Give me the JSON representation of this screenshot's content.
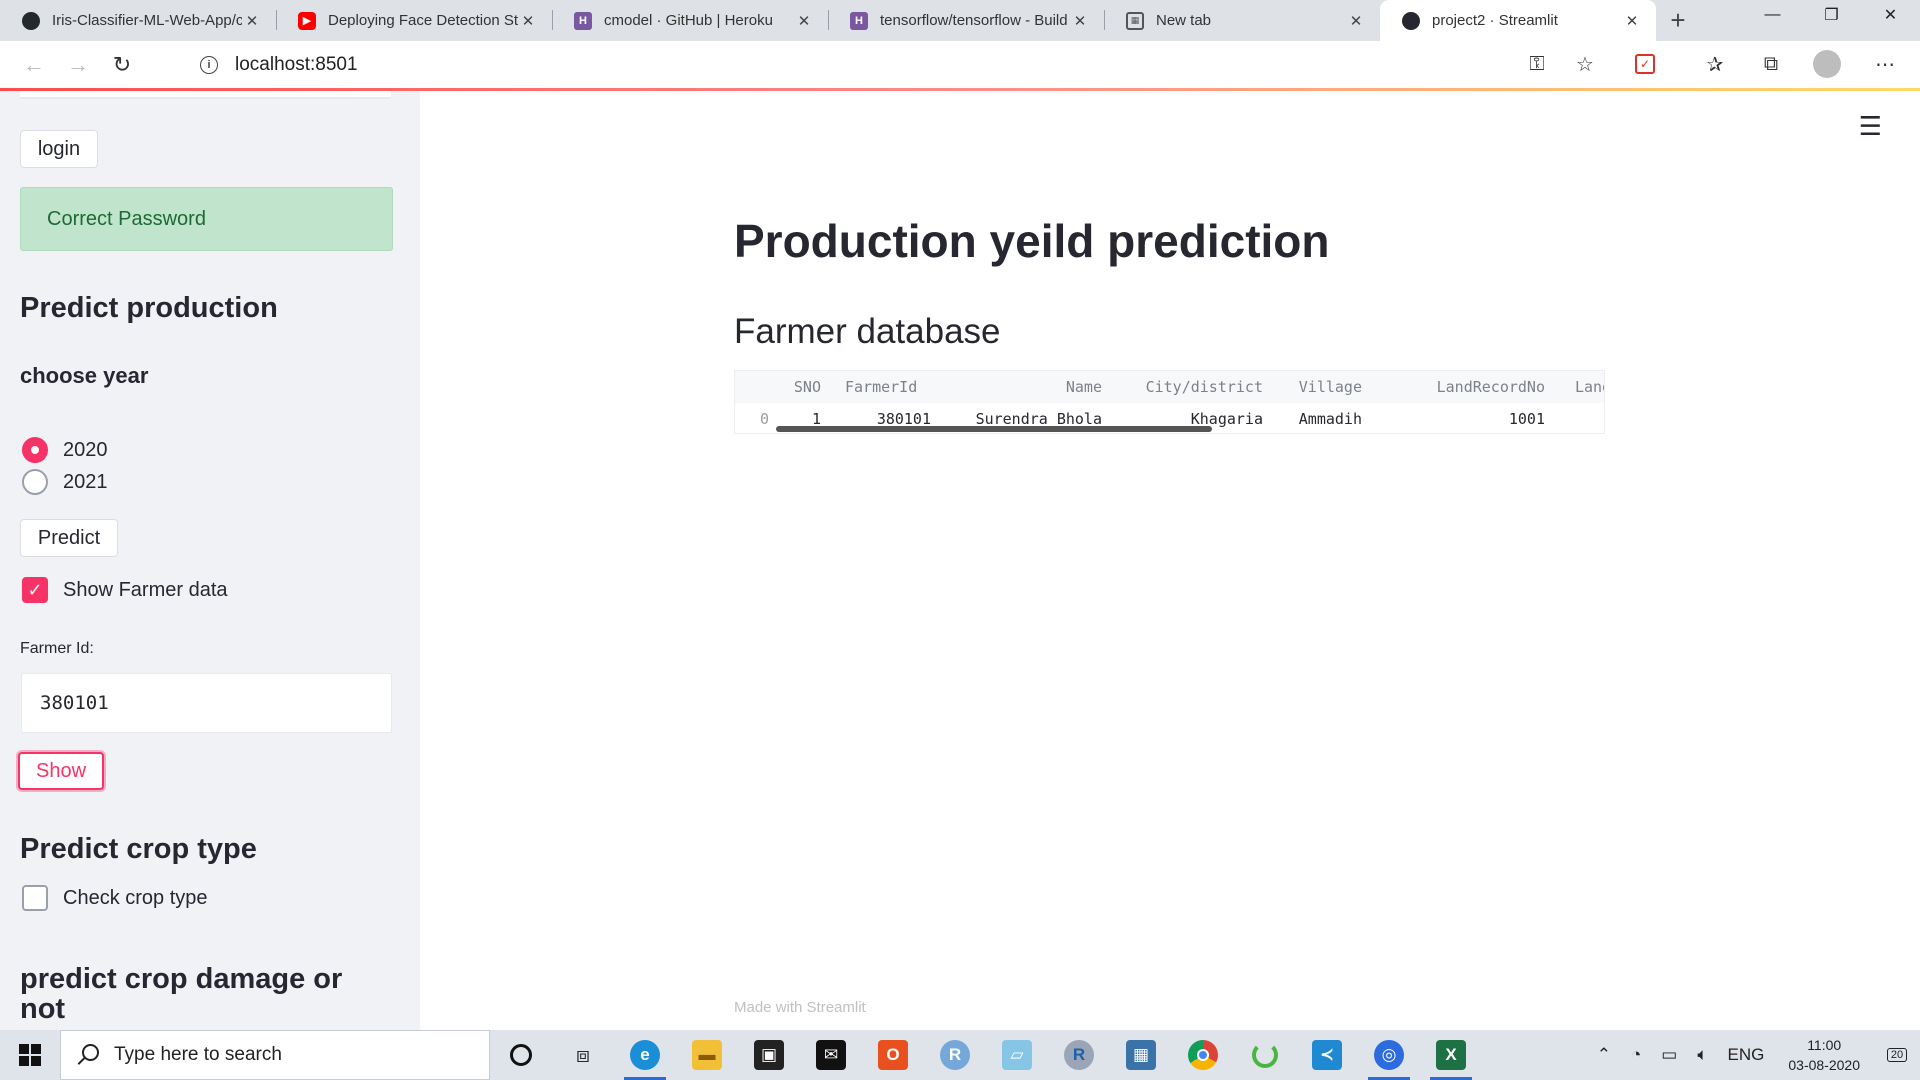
{
  "browser": {
    "tabs": [
      {
        "title": "Iris-Classifier-ML-Web-App/c",
        "favicon": "github-icon",
        "active": false
      },
      {
        "title": "Deploying Face Detection St",
        "favicon": "youtube-icon",
        "active": false
      },
      {
        "title": "cmodel · GitHub | Heroku",
        "favicon": "heroku-icon",
        "active": false
      },
      {
        "title": "tensorflow/tensorflow - Build",
        "favicon": "heroku-icon",
        "active": false
      },
      {
        "title": "New tab",
        "favicon": "newtab-icon",
        "active": false
      },
      {
        "title": "project2 · Streamlit",
        "favicon": "streamlit-icon",
        "active": true
      }
    ],
    "url": "localhost:8501"
  },
  "sidebar": {
    "login_button": "login",
    "success_message": "Correct Password",
    "predict_production_heading": "Predict production",
    "choose_year_label": "choose year",
    "year_options": [
      {
        "label": "2020",
        "selected": true
      },
      {
        "label": "2021",
        "selected": false
      }
    ],
    "predict_button": "Predict",
    "show_farmer_checkbox": {
      "label": "Show Farmer data",
      "checked": true
    },
    "farmer_id_label": "Farmer Id:",
    "farmer_id_value": "380101",
    "show_button": "Show",
    "predict_crop_type_heading": "Predict crop type",
    "check_crop_type_checkbox": {
      "label": "Check crop type",
      "checked": false
    },
    "predict_damage_heading": "predict crop damage or not"
  },
  "main": {
    "title": "Production yeild prediction",
    "section_title": "Farmer database",
    "table": {
      "columns": [
        "",
        "SNO",
        "FarmerId",
        "Name",
        "City/district",
        "Village",
        "LandRecordNo",
        "LandAı"
      ],
      "rows": [
        [
          "0",
          "1",
          "380101",
          "Surendra Bhola",
          "Khagaria",
          "Ammadih",
          "1001",
          ""
        ]
      ]
    },
    "footer": "Made with Streamlit"
  },
  "taskbar": {
    "search_placeholder": "Type here to search",
    "language": "ENG",
    "time": "11:00",
    "date": "03-08-2020",
    "notification_count": "20",
    "apps": [
      "cortana-icon",
      "task-view-icon",
      "edge-icon",
      "file-explorer-icon",
      "store-icon",
      "mail-icon",
      "office-icon",
      "rstudio-icon",
      "notepad-icon",
      "r-icon",
      "python-icon",
      "chrome-icon",
      "spinner-icon",
      "vscode-icon",
      "anaconda-icon",
      "excel-icon"
    ]
  },
  "colors": {
    "accent": "#f63366",
    "success_bg": "#c1e5cc",
    "sidebar_bg": "#f0f2f6"
  }
}
